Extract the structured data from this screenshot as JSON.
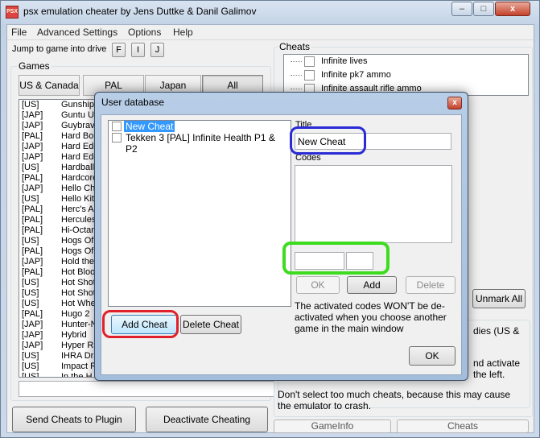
{
  "window": {
    "title": "psx emulation cheater by Jens Duttke & Danil Galimov",
    "icon": "app-logo-icon",
    "controls": {
      "minimize": "–",
      "maximize": "□",
      "close": "x"
    }
  },
  "menu": [
    "File",
    "Advanced Settings",
    "Options",
    "Help"
  ],
  "jump": {
    "label": "Jump to game into drive",
    "buttons": [
      "F",
      "I",
      "J"
    ]
  },
  "games": {
    "group_label": "Games",
    "tabs": [
      "US & Canada",
      "PAL",
      "Japan",
      "All"
    ],
    "active_tab": "All",
    "rows": [
      {
        "region": "[US]",
        "name": "Gunship"
      },
      {
        "region": "[JAP]",
        "name": "Guntu US"
      },
      {
        "region": "[JAP]",
        "name": "Guybrave"
      },
      {
        "region": "[PAL]",
        "name": "Hard Boil"
      },
      {
        "region": "[JAP]",
        "name": "Hard Edg"
      },
      {
        "region": "[JAP]",
        "name": "Hard Edg"
      },
      {
        "region": "[US]",
        "name": "Hardball"
      },
      {
        "region": "[PAL]",
        "name": "Hardcore"
      },
      {
        "region": "[JAP]",
        "name": "Hello Cha"
      },
      {
        "region": "[US]",
        "name": "Hello Kitt"
      },
      {
        "region": "[PAL]",
        "name": "Herc's Ad"
      },
      {
        "region": "[PAL]",
        "name": "Hercules"
      },
      {
        "region": "[PAL]",
        "name": "Hi-Octan"
      },
      {
        "region": "[US]",
        "name": "Hogs Of"
      },
      {
        "region": "[PAL]",
        "name": "Hogs Of"
      },
      {
        "region": "[JAP]",
        "name": "Hold the"
      },
      {
        "region": "[PAL]",
        "name": "Hot Bloo"
      },
      {
        "region": "[US]",
        "name": "Hot Shot"
      },
      {
        "region": "[US]",
        "name": "Hot Shot"
      },
      {
        "region": "[US]",
        "name": "Hot Whe"
      },
      {
        "region": "[PAL]",
        "name": "Hugo 2"
      },
      {
        "region": "[JAP]",
        "name": "Hunter-N"
      },
      {
        "region": "[JAP]",
        "name": "Hybrid"
      },
      {
        "region": "[JAP]",
        "name": "Hyper Ra"
      },
      {
        "region": "[US]",
        "name": "IHRA Dra"
      },
      {
        "region": "[US]",
        "name": "Impact R"
      },
      {
        "region": "[US]",
        "name": "In the H"
      }
    ]
  },
  "cheats": {
    "group_label": "Cheats",
    "items": [
      "Infinite lives",
      "Infinite pk7 ammo",
      "Infinite assault rifle ammo"
    ],
    "unmark_all": "Unmark All"
  },
  "info": {
    "text1": "dies (US &",
    "text2": "nd activate",
    "text3": "the left.",
    "text4": "Don't select too much cheats, because this may cause the emulator to crash."
  },
  "bottom_buttons": {
    "send": "Send Cheats to Plugin",
    "deactivate": "Deactivate Cheating"
  },
  "bottom_tabs": [
    "GameInfo",
    "Cheats"
  ],
  "dialog": {
    "title": "User database",
    "close": "x",
    "list": [
      {
        "label": "New Cheat",
        "checked": false,
        "selected": true
      },
      {
        "label": "Tekken 3 [PAL] Infinite Health P1 & P2",
        "checked": false,
        "selected": false
      }
    ],
    "title_label": "Title",
    "title_value": "New Cheat",
    "codes_label": "Codes",
    "code_address": "",
    "code_value": "",
    "ok_small": "OK",
    "add": "Add",
    "delete": "Delete",
    "note": "The activated codes WON'T be de-activated when you choose another game in the main window",
    "add_cheat": "Add Cheat",
    "delete_cheat": "Delete Cheat",
    "ok": "OK"
  },
  "highlights": {
    "blue": "#2a2ad6",
    "red": "#e0202a",
    "green": "#3ddc1e"
  }
}
